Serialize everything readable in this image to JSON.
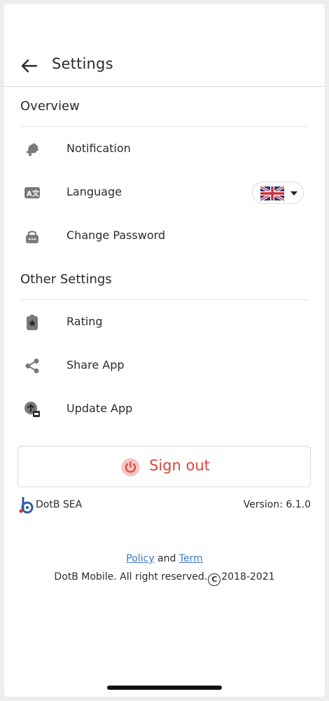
{
  "header": {
    "title": "Settings"
  },
  "sections": {
    "overview": {
      "title": "Overview",
      "items": [
        {
          "label": "Notification",
          "icon": "bell-icon"
        },
        {
          "label": "Language",
          "icon": "translate-icon"
        },
        {
          "label": "Change Password",
          "icon": "lock-icon"
        }
      ]
    },
    "other": {
      "title": "Other Settings",
      "items": [
        {
          "label": "Rating",
          "icon": "star-badge-icon"
        },
        {
          "label": "Share App",
          "icon": "share-icon"
        },
        {
          "label": "Update App",
          "icon": "upload-icon"
        }
      ]
    }
  },
  "language_selector": {
    "flag": "uk-flag-icon",
    "caret": "caret-down-icon"
  },
  "signout": {
    "label": "Sign out",
    "icon": "power-icon",
    "color": "#e0443b"
  },
  "footer": {
    "brand": "DotB SEA",
    "version": "Version: 6.1.0",
    "policy_link": "Policy",
    "and_text": "and",
    "term_link": "Term",
    "copyright_prefix": "DotB Mobile. All right reserved.",
    "copyright_symbol": "C",
    "copyright_years": "2018-2021"
  },
  "colors": {
    "accent": "#e0443b",
    "link": "#3f78c8",
    "icon": "#7a7a7a",
    "text": "#2b2b2b"
  }
}
